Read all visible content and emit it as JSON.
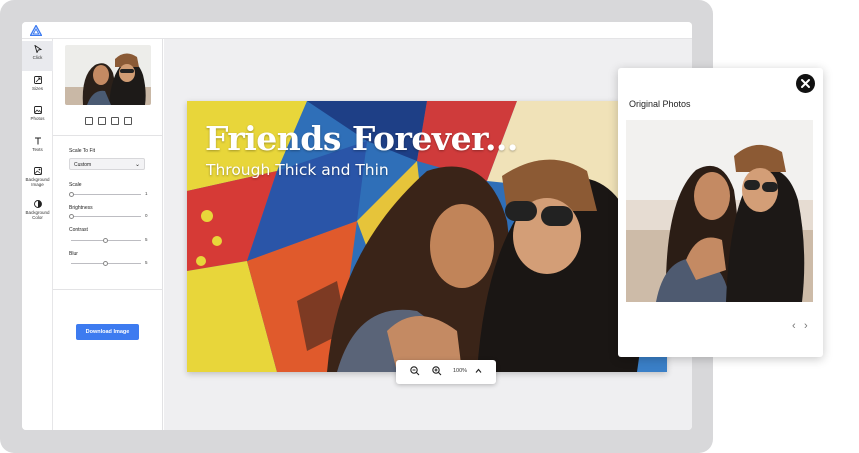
{
  "app": {
    "brand_color": "#3d7bf0",
    "accent": "#3d7bf0"
  },
  "rail": {
    "items": [
      {
        "label": "Click",
        "icon": "cursor-icon"
      },
      {
        "label": "Sizes",
        "icon": "resize-icon"
      },
      {
        "label": "Photos",
        "icon": "photo-icon"
      },
      {
        "label": "Texts",
        "icon": "text-icon"
      },
      {
        "label": "Background Image",
        "icon": "background-image-icon"
      },
      {
        "label": "Background Color",
        "icon": "contrast-icon"
      }
    ]
  },
  "panel": {
    "scale_to_fit_label": "Scale To Fit",
    "scale_select_value": "Custom",
    "sliders": [
      {
        "label": "Scale",
        "value": "1",
        "level": 1.0
      },
      {
        "label": "Brightness",
        "value": "0",
        "level": 0.0
      },
      {
        "label": "Contrast",
        "value": "5",
        "level": 0.5
      },
      {
        "label": "Blur",
        "value": "5",
        "level": 0.5
      }
    ],
    "download_label": "Download Image"
  },
  "canvas": {
    "title": "Friends Forever...",
    "subtitle": "Through Thick and Thin",
    "zoom_value": "100%"
  },
  "popup": {
    "title": "Original Photos"
  }
}
